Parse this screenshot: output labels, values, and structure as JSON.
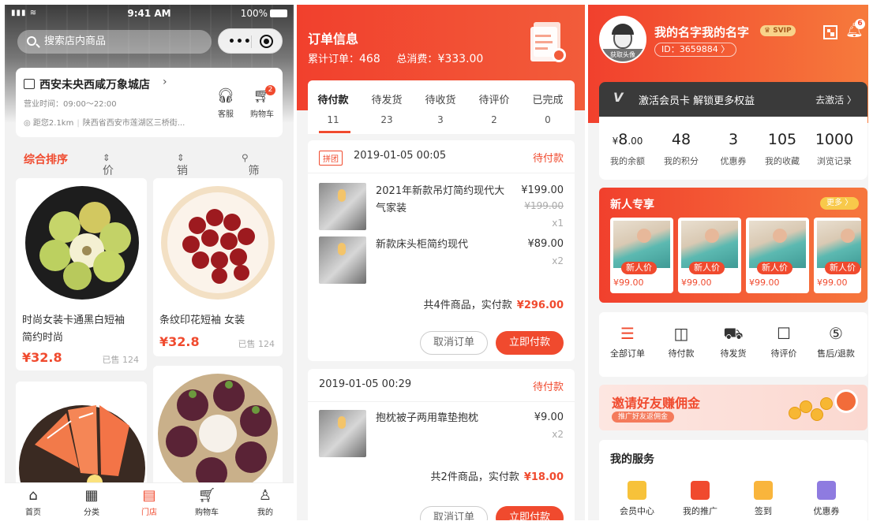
{
  "panel1": {
    "status": {
      "signal": "▮▮▮ ≋",
      "time": "9:41 AM",
      "battery": "100%"
    },
    "search": {
      "placeholder": "搜索店内商品"
    },
    "capsule": {
      "more_icon": "more-dots-icon",
      "close_icon": "target-icon"
    },
    "store": {
      "name": "西安未央西咸万象城店",
      "hours": "营业时间：09:00～22:00",
      "distance": "距您2.1km",
      "address": "陕西省西安市莲湖区三桥街...",
      "service_label": "客服",
      "cart_label": "购物车",
      "cart_badge": "2"
    },
    "sort": {
      "composite": "综合排序",
      "price": "价格",
      "sales": "销量",
      "filter": "筛选"
    },
    "products": [
      {
        "title_l1": "时尚女装卡通黑白短袖",
        "title_l2": "简约时尚",
        "price": "¥32.8",
        "sold": "已售 124"
      },
      {
        "title_l1": "条纹印花短袖 女装",
        "title_l2": "",
        "price": "¥32.8",
        "sold": "已售 124"
      },
      {
        "title_l1": "",
        "title_l2": "",
        "price": "",
        "sold": ""
      },
      {
        "title_l1": "",
        "title_l2": "",
        "price": "",
        "sold": ""
      }
    ],
    "tabbar": [
      {
        "label": "首页",
        "icon": "home-icon"
      },
      {
        "label": "分类",
        "icon": "grid-icon"
      },
      {
        "label": "门店",
        "icon": "store-icon"
      },
      {
        "label": "购物车",
        "icon": "cart-icon"
      },
      {
        "label": "我的",
        "icon": "user-icon"
      }
    ]
  },
  "panel2": {
    "title": "订单信息",
    "total_orders_label": "累计订单：",
    "total_orders": "468",
    "total_spent_label": "总消费：",
    "total_spent": "¥333.00",
    "tabs": [
      {
        "label": "待付款",
        "count": "11"
      },
      {
        "label": "待发货",
        "count": "23"
      },
      {
        "label": "待收货",
        "count": "3"
      },
      {
        "label": "待评价",
        "count": "2"
      },
      {
        "label": "已完成",
        "count": "0"
      }
    ],
    "orders": [
      {
        "tag": "拼团",
        "date": "2019-01-05 00:05",
        "status": "待付款",
        "items": [
          {
            "name": "2021年新款吊灯简约现代大气家装",
            "price": "¥199.00",
            "orig": "¥199.00",
            "qty": "x1"
          },
          {
            "name": "新款床头柜简约现代",
            "price": "¥89.00",
            "orig": "",
            "qty": "x2"
          }
        ],
        "summary": "共4件商品，实付款",
        "amount": "¥296.00",
        "cancel": "取消订单",
        "pay": "立即付款"
      },
      {
        "tag": "",
        "date": "2019-01-05 00:29",
        "status": "待付款",
        "items": [
          {
            "name": "抱枕被子两用靠垫抱枕",
            "price": "¥9.00",
            "orig": "",
            "qty": "x2"
          }
        ],
        "summary": "共2件商品，实付款",
        "amount": "¥18.00",
        "cancel": "取消订单",
        "pay": "立即付款"
      }
    ]
  },
  "panel3": {
    "avatar_caption": "获取头像",
    "username": "我的名字我的名字",
    "vip_badge": "SVIP",
    "id": "ID：3659884 〉",
    "notif_badge": "6",
    "vip": {
      "icon": "V",
      "text": "激活会员卡 解锁更多权益",
      "action": "去激活 〉"
    },
    "stats": [
      {
        "prefix": "¥",
        "value": "8",
        "suffix": ".00",
        "label": "我的余额"
      },
      {
        "prefix": "",
        "value": "48",
        "suffix": "",
        "label": "我的积分"
      },
      {
        "prefix": "",
        "value": "3",
        "suffix": "",
        "label": "优惠券"
      },
      {
        "prefix": "",
        "value": "105",
        "suffix": "",
        "label": "我的收藏"
      },
      {
        "prefix": "",
        "value": "1000",
        "suffix": "",
        "label": "浏览记录"
      }
    ],
    "newcomer": {
      "title": "新人专享",
      "more": "更多 〉",
      "tag": "新人价",
      "price": "¥99.00"
    },
    "order_entries": [
      {
        "label": "全部订单",
        "icon": "order-list-icon",
        "glyph": "☰"
      },
      {
        "label": "待付款",
        "icon": "wallet-icon",
        "glyph": "◫"
      },
      {
        "label": "待发货",
        "icon": "truck-icon",
        "glyph": "⛟"
      },
      {
        "label": "待评价",
        "icon": "comment-icon",
        "glyph": "☐"
      },
      {
        "label": "售后/退款",
        "icon": "refund-icon",
        "glyph": "⑤"
      }
    ],
    "invite": {
      "title": "邀请好友赚佣金",
      "sub": "推广好友返佣金"
    },
    "services": {
      "title": "我的服务",
      "items": [
        {
          "label": "会员中心",
          "color": "#f7c23a"
        },
        {
          "label": "我的推广",
          "color": "#f04a2e"
        },
        {
          "label": "签到",
          "color": "#f9b53c"
        },
        {
          "label": "优惠券",
          "color": "#8e7be0"
        }
      ]
    }
  }
}
